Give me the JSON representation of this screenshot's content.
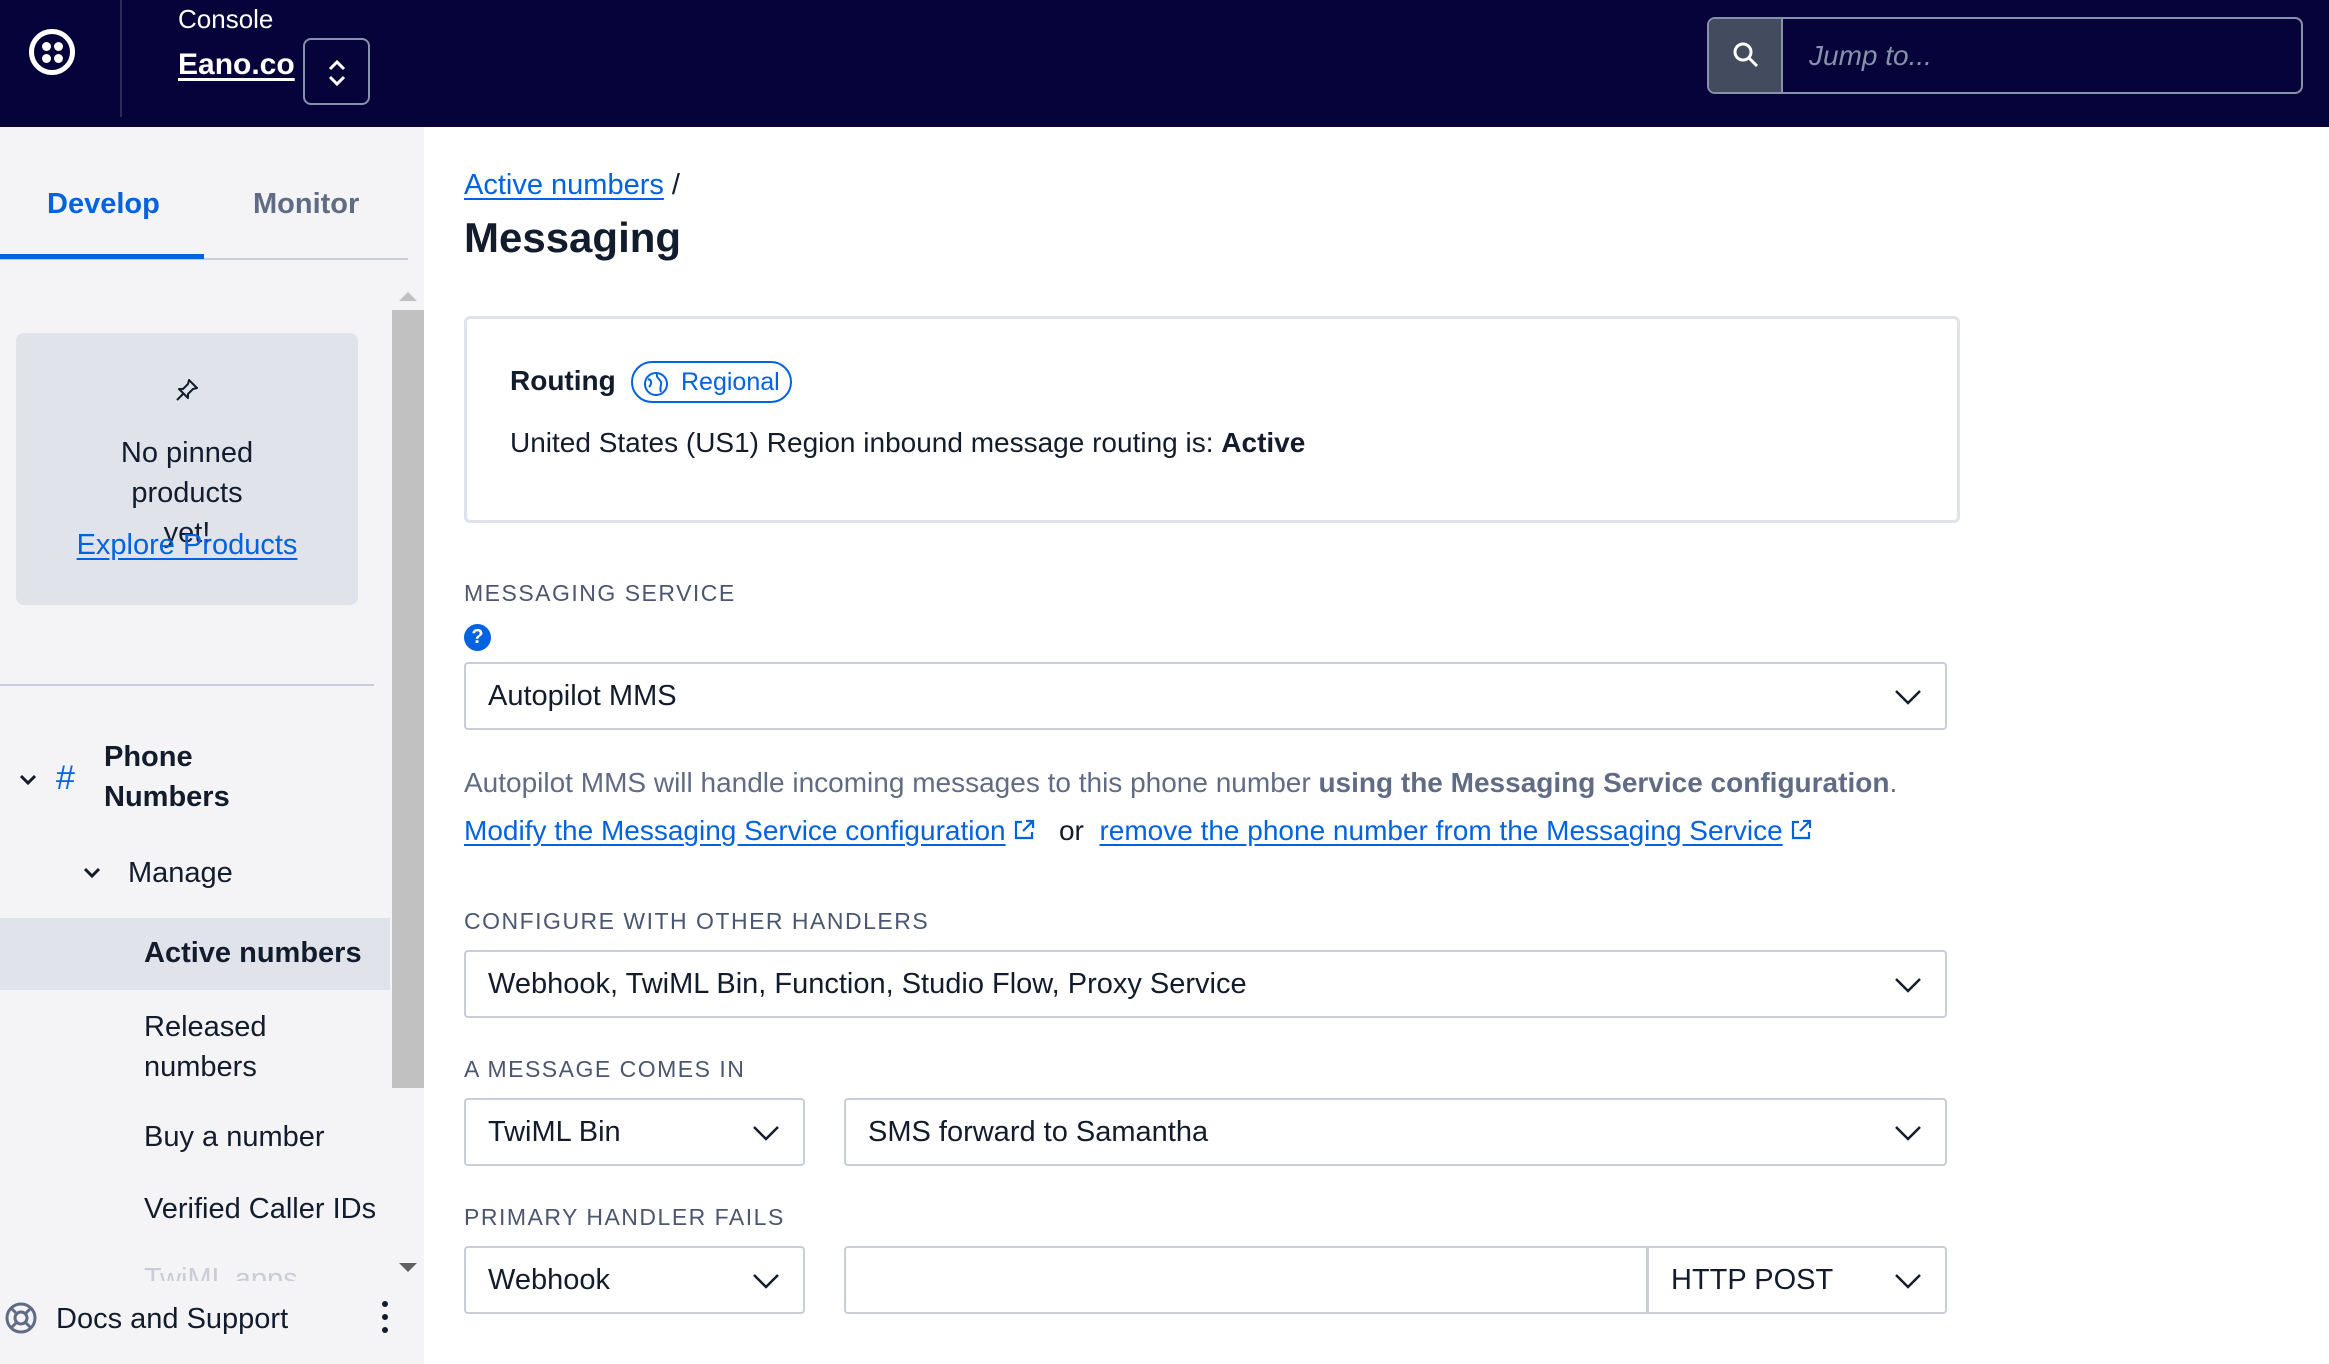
{
  "header": {
    "console_label": "Console",
    "account_name": "Eano.co",
    "search_placeholder": "Jump to..."
  },
  "sidebar": {
    "tabs": [
      {
        "label": "Develop",
        "active": true
      },
      {
        "label": "Monitor",
        "active": false
      }
    ],
    "pinned": {
      "message": "No pinned products yet!",
      "link": "Explore Products"
    },
    "nav": {
      "section": "Phone Numbers",
      "group": "Manage",
      "items": [
        {
          "label": "Active numbers",
          "active": true
        },
        {
          "label": "Released numbers",
          "active": false
        },
        {
          "label": "Buy a number",
          "active": false
        },
        {
          "label": "Verified Caller IDs",
          "active": false
        },
        {
          "label": "TwiML apps",
          "active": false
        }
      ]
    },
    "footer": {
      "docs_label": "Docs and Support"
    }
  },
  "main": {
    "breadcrumb": {
      "link": "Active numbers",
      "separator": "/"
    },
    "title": "Messaging",
    "routing": {
      "title": "Routing",
      "badge": "Regional",
      "text_prefix": "United States (US1) Region inbound message routing is: ",
      "status": "Active"
    },
    "messaging_service": {
      "label": "MESSAGING SERVICE",
      "value": "Autopilot MMS",
      "info_prefix": "Autopilot MMS will handle incoming messages to this phone number ",
      "info_bold": "using the Messaging Service configuration",
      "info_suffix": ".",
      "modify_link": "Modify the Messaging Service configuration",
      "or_text": "or",
      "remove_link": "remove the phone number from the Messaging Service"
    },
    "other_handlers": {
      "label": "CONFIGURE WITH OTHER HANDLERS",
      "value": "Webhook, TwiML Bin, Function, Studio Flow, Proxy Service"
    },
    "message_comes_in": {
      "label": "A MESSAGE COMES IN",
      "type": "TwiML Bin",
      "target": "SMS forward to Samantha"
    },
    "primary_handler_fails": {
      "label": "PRIMARY HANDLER FAILS",
      "type": "Webhook",
      "url_value": "",
      "method": "HTTP POST"
    }
  },
  "colors": {
    "topbar": "#06033a",
    "accent": "#0263e0",
    "sidebar_bg": "#f4f4f6"
  }
}
